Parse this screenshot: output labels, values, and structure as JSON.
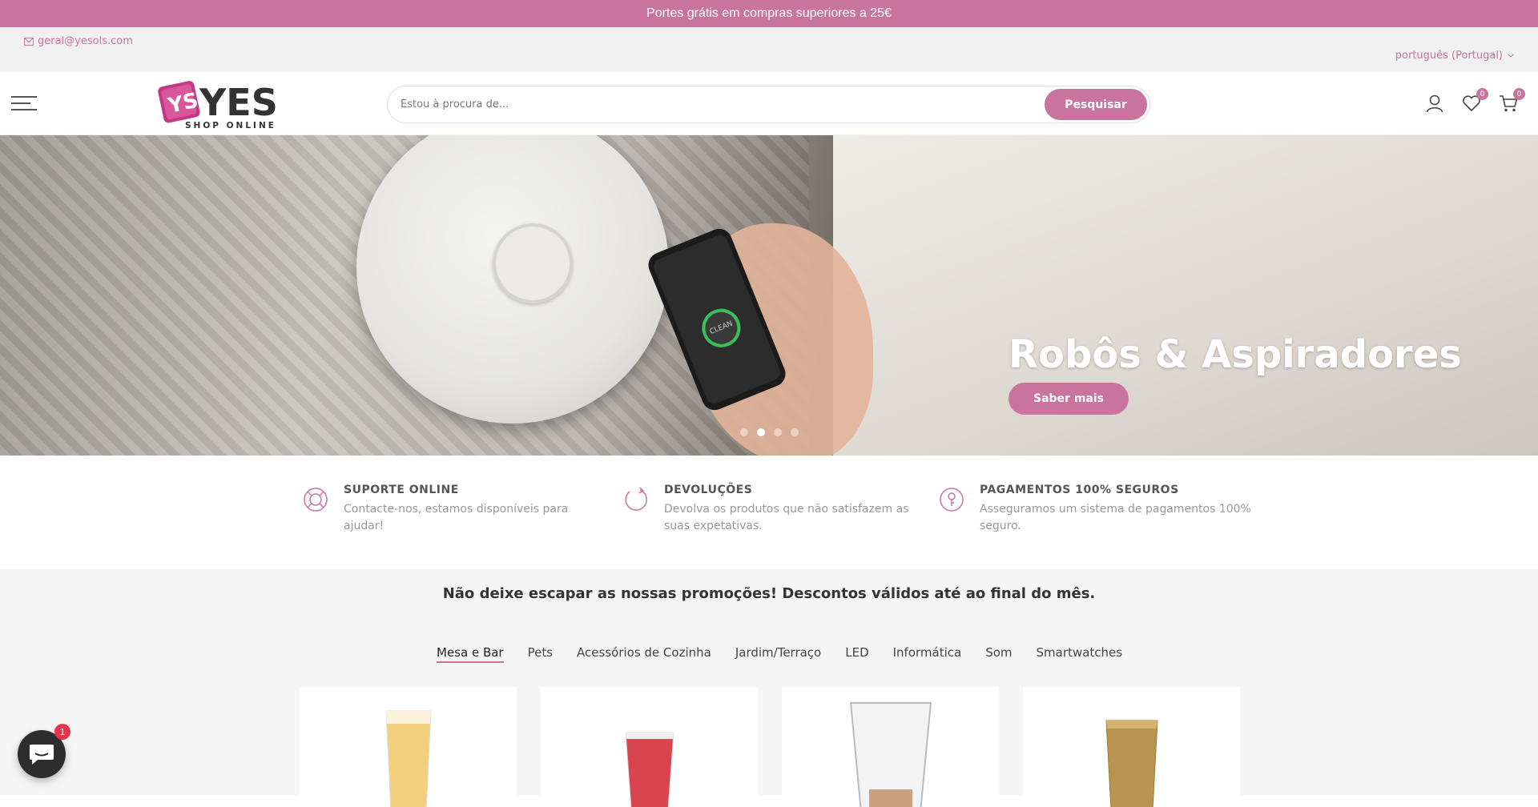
{
  "announcement": {
    "text": "Portes grátis em compras superiores a 25€"
  },
  "info": {
    "email": "geral@yesols.com",
    "language": "português (Portugal)"
  },
  "logo": {
    "main": "YES",
    "sub": "SHOP ONLINE"
  },
  "search": {
    "placeholder": "Estou à procura de...",
    "button": "Pesquisar"
  },
  "header_icons": {
    "wishlist_count": "0",
    "cart_count": "0"
  },
  "hero": {
    "title": "Robôs & Aspiradores",
    "button": "Saber mais",
    "phone_button": "CLEAN",
    "active_slide": 2,
    "slides": 4
  },
  "features": [
    {
      "title": "SUPORTE ONLINE",
      "text": "Contacte-nos, estamos disponíveis para ajudar!",
      "icon": "lifebuoy-icon"
    },
    {
      "title": "DEVOLUÇÕES",
      "text": "Devolva os produtos que não satisfazem as suas expetativas.",
      "icon": "return-icon"
    },
    {
      "title": "PAGAMENTOS 100% SEGUROS",
      "text": "Asseguramos um sistema de pagamentos 100% seguro.",
      "icon": "secure-payment-icon"
    }
  ],
  "promo": {
    "heading": "Não deixe escapar as nossas promoções! Descontos válidos até ao final do mês."
  },
  "tabs": [
    "Mesa e Bar",
    "Pets",
    "Acessórios de Cozinha",
    "Jardim/Terraço",
    "LED",
    "Informática",
    "Som",
    "Smartwatches"
  ],
  "chat": {
    "badge": "1"
  },
  "colors": {
    "accent": "#c9739f",
    "topbar": "#c9739f",
    "info_bg": "#f1f1f1"
  }
}
